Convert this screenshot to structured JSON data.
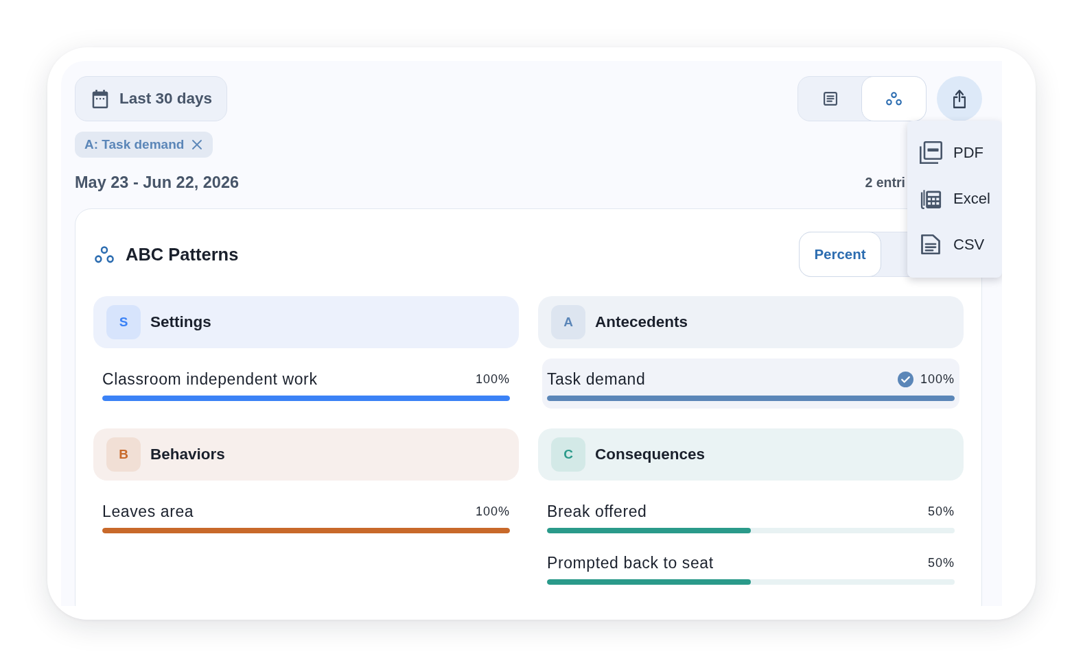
{
  "date_filter": {
    "label": "Last 30 days"
  },
  "view_toggle": [
    {
      "kind": "list",
      "selected": false
    },
    {
      "kind": "patterns",
      "selected": true
    }
  ],
  "export": {
    "expanded": true,
    "menu": [
      {
        "kind": "pdf",
        "label": "PDF"
      },
      {
        "kind": "excel",
        "label": "Excel"
      },
      {
        "kind": "csv",
        "label": "CSV"
      }
    ]
  },
  "active_filters": [
    {
      "label": "A: Task demand"
    }
  ],
  "date_range": "May 23 - Jun 22, 2026",
  "entry_count": "2 entri",
  "patterns": {
    "title": "ABC Patterns",
    "unit_toggle": [
      {
        "label": "Percent",
        "selected": true
      }
    ],
    "sections": [
      {
        "letter": "S",
        "title": "Settings",
        "color": "#3b82f6",
        "items": [
          {
            "label": "Classroom independent work",
            "reading": "100%",
            "level": 1,
            "selected": false
          }
        ]
      },
      {
        "letter": "A",
        "title": "Antecedents",
        "color": "#5b86b8",
        "items": [
          {
            "label": "Task demand",
            "reading": "100%",
            "level": 1,
            "selected": true
          }
        ]
      },
      {
        "letter": "B",
        "title": "Behaviors",
        "color": "#c8692a",
        "items": [
          {
            "label": "Leaves area",
            "reading": "100%",
            "level": 1,
            "selected": false
          }
        ]
      },
      {
        "letter": "C",
        "title": "Consequences",
        "color": "#2a9a8a",
        "items": [
          {
            "label": "Break offered",
            "reading": "50%",
            "level": 0.5,
            "selected": false
          },
          {
            "label": "Prompted back to seat",
            "reading": "50%",
            "level": 0.5,
            "selected": false
          }
        ]
      }
    ]
  }
}
